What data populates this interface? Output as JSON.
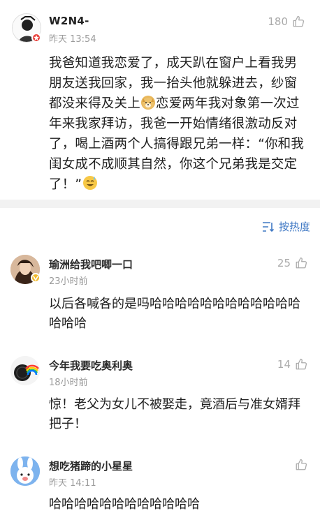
{
  "post": {
    "author": "W2N4-",
    "time": "昨天 13:54",
    "likes": "180",
    "text_part1": "我爸知道我恋爱了，成天趴在窗户上看我男朋友送我回家，我一抬头他就躲进去，纱窗都没来得及关上",
    "text_part2": "恋爱两年我对象第一次过年来我家拜访，我爸一开始情绪很激动反对了，喝上酒两个人搞得跟兄弟一样：“你和我闺女成不成顺其自然，你这个兄弟我是交定了！”",
    "emoji1": "doge-emoji",
    "emoji2": "sweat-smile-emoji"
  },
  "sort": {
    "label": "按热度"
  },
  "comments": [
    {
      "author": "瑜洲给我吧唧一口",
      "time": "23小时前",
      "likes": "25",
      "text": "以后各喊各的是吗哈哈哈哈哈哈哈哈哈哈哈哈哈哈哈"
    },
    {
      "author": "今年我要吃奥利奥",
      "time": "18小时前",
      "likes": "14",
      "text": "惊！老父为女儿不被娶走，竟酒后与准女婿拜把子！"
    },
    {
      "author": "想吃猪蹄的小星星",
      "time": "昨天 14:11",
      "likes": "",
      "text": "哈哈哈哈哈哈哈哈哈哈哈哈"
    }
  ],
  "colors": {
    "link": "#3f78c4",
    "muted": "#9a9a9a",
    "divider": "#f2f2f2"
  }
}
